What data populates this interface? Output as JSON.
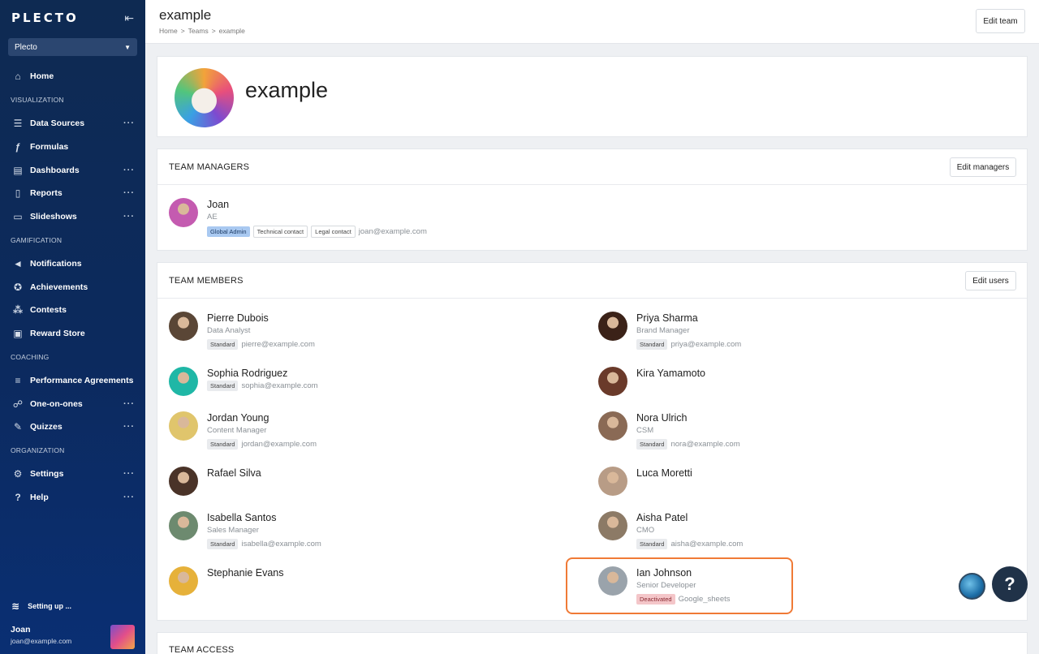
{
  "sidebar": {
    "logo": "PLECTO",
    "org": "Plecto",
    "nav": [
      {
        "type": "item",
        "label": "Home",
        "icon": "home-icon",
        "more": false
      },
      {
        "type": "section",
        "label": "VISUALIZATION"
      },
      {
        "type": "item",
        "label": "Data Sources",
        "icon": "database-icon",
        "more": true
      },
      {
        "type": "item",
        "label": "Formulas",
        "icon": "function-icon",
        "more": false
      },
      {
        "type": "item",
        "label": "Dashboards",
        "icon": "chart-icon",
        "more": true
      },
      {
        "type": "item",
        "label": "Reports",
        "icon": "report-icon",
        "more": true
      },
      {
        "type": "item",
        "label": "Slideshows",
        "icon": "monitor-icon",
        "more": true
      },
      {
        "type": "section",
        "label": "GAMIFICATION"
      },
      {
        "type": "item",
        "label": "Notifications",
        "icon": "megaphone-icon",
        "more": false
      },
      {
        "type": "item",
        "label": "Achievements",
        "icon": "medal-icon",
        "more": false
      },
      {
        "type": "item",
        "label": "Contests",
        "icon": "contest-icon",
        "more": false
      },
      {
        "type": "item",
        "label": "Reward Store",
        "icon": "gift-icon",
        "more": false
      },
      {
        "type": "section",
        "label": "COACHING"
      },
      {
        "type": "item",
        "label": "Performance Agreements",
        "icon": "agreement-icon",
        "more": false
      },
      {
        "type": "item",
        "label": "One-on-ones",
        "icon": "chat-icon",
        "more": true
      },
      {
        "type": "item",
        "label": "Quizzes",
        "icon": "quiz-icon",
        "more": true
      },
      {
        "type": "section",
        "label": "ORGANIZATION"
      },
      {
        "type": "item",
        "label": "Settings",
        "icon": "gear-icon",
        "more": true
      },
      {
        "type": "item",
        "label": "Help",
        "icon": "help-icon",
        "more": true
      }
    ],
    "setup_label": "Setting up ...",
    "user": {
      "name": "Joan",
      "email": "joan@example.com"
    }
  },
  "header": {
    "title": "example",
    "breadcrumb": [
      "Home",
      ">",
      "Teams",
      ">",
      "example"
    ],
    "edit_team": "Edit team"
  },
  "hero": {
    "name": "example"
  },
  "managers": {
    "title": "TEAM MANAGERS",
    "edit_label": "Edit managers",
    "people": [
      {
        "name": "Joan",
        "role": "AE",
        "tags": [
          [
            "Global Admin",
            "blue"
          ],
          [
            "Technical contact",
            "out"
          ],
          [
            "Legal contact",
            "out"
          ]
        ],
        "email": "joan@example.com",
        "avatar": "#c45bb0"
      }
    ]
  },
  "members": {
    "title": "TEAM MEMBERS",
    "edit_label": "Edit users",
    "people": [
      {
        "name": "Pierre Dubois",
        "role": "Data Analyst",
        "tags": [
          [
            "Standard",
            ""
          ]
        ],
        "email": "pierre@example.com",
        "avatar": "#5a4636"
      },
      {
        "name": "Priya Sharma",
        "role": "Brand Manager",
        "tags": [
          [
            "Standard",
            ""
          ]
        ],
        "email": "priya@example.com",
        "avatar": "#3b2218"
      },
      {
        "name": "Sophia Rodriguez",
        "role": "",
        "tags": [
          [
            "Standard",
            ""
          ]
        ],
        "email": "sophia@example.com",
        "avatar": "#1fb7a6"
      },
      {
        "name": "Kira Yamamoto",
        "role": "",
        "tags": [],
        "email": "",
        "avatar": "#6a3a2a"
      },
      {
        "name": "Jordan Young",
        "role": "Content Manager",
        "tags": [
          [
            "Standard",
            ""
          ]
        ],
        "email": "jordan@example.com",
        "avatar": "#e0c56c"
      },
      {
        "name": "Nora Ulrich",
        "role": "CSM",
        "tags": [
          [
            "Standard",
            ""
          ]
        ],
        "email": "nora@example.com",
        "avatar": "#8a6a55"
      },
      {
        "name": "Rafael Silva",
        "role": "",
        "tags": [],
        "email": "",
        "avatar": "#4a3328"
      },
      {
        "name": "Luca Moretti",
        "role": "",
        "tags": [],
        "email": "",
        "avatar": "#b89c86"
      },
      {
        "name": "Isabella Santos",
        "role": "Sales Manager",
        "tags": [
          [
            "Standard",
            ""
          ]
        ],
        "email": "isabella@example.com",
        "avatar": "#6d8a6f"
      },
      {
        "name": "Aisha Patel",
        "role": "CMO",
        "tags": [
          [
            "Standard",
            ""
          ]
        ],
        "email": "aisha@example.com",
        "avatar": "#8c7a66"
      },
      {
        "name": "Stephanie Evans",
        "role": "",
        "tags": [],
        "email": "",
        "avatar": "#e6b13a"
      },
      {
        "name": "Ian Johnson",
        "role": "Senior Developer",
        "tags": [
          [
            "Deactivated",
            "red"
          ]
        ],
        "email": "Google_sheets",
        "avatar": "#9aa3ab"
      }
    ]
  },
  "access": {
    "title": "TEAM ACCESS"
  },
  "help_fab": "?"
}
